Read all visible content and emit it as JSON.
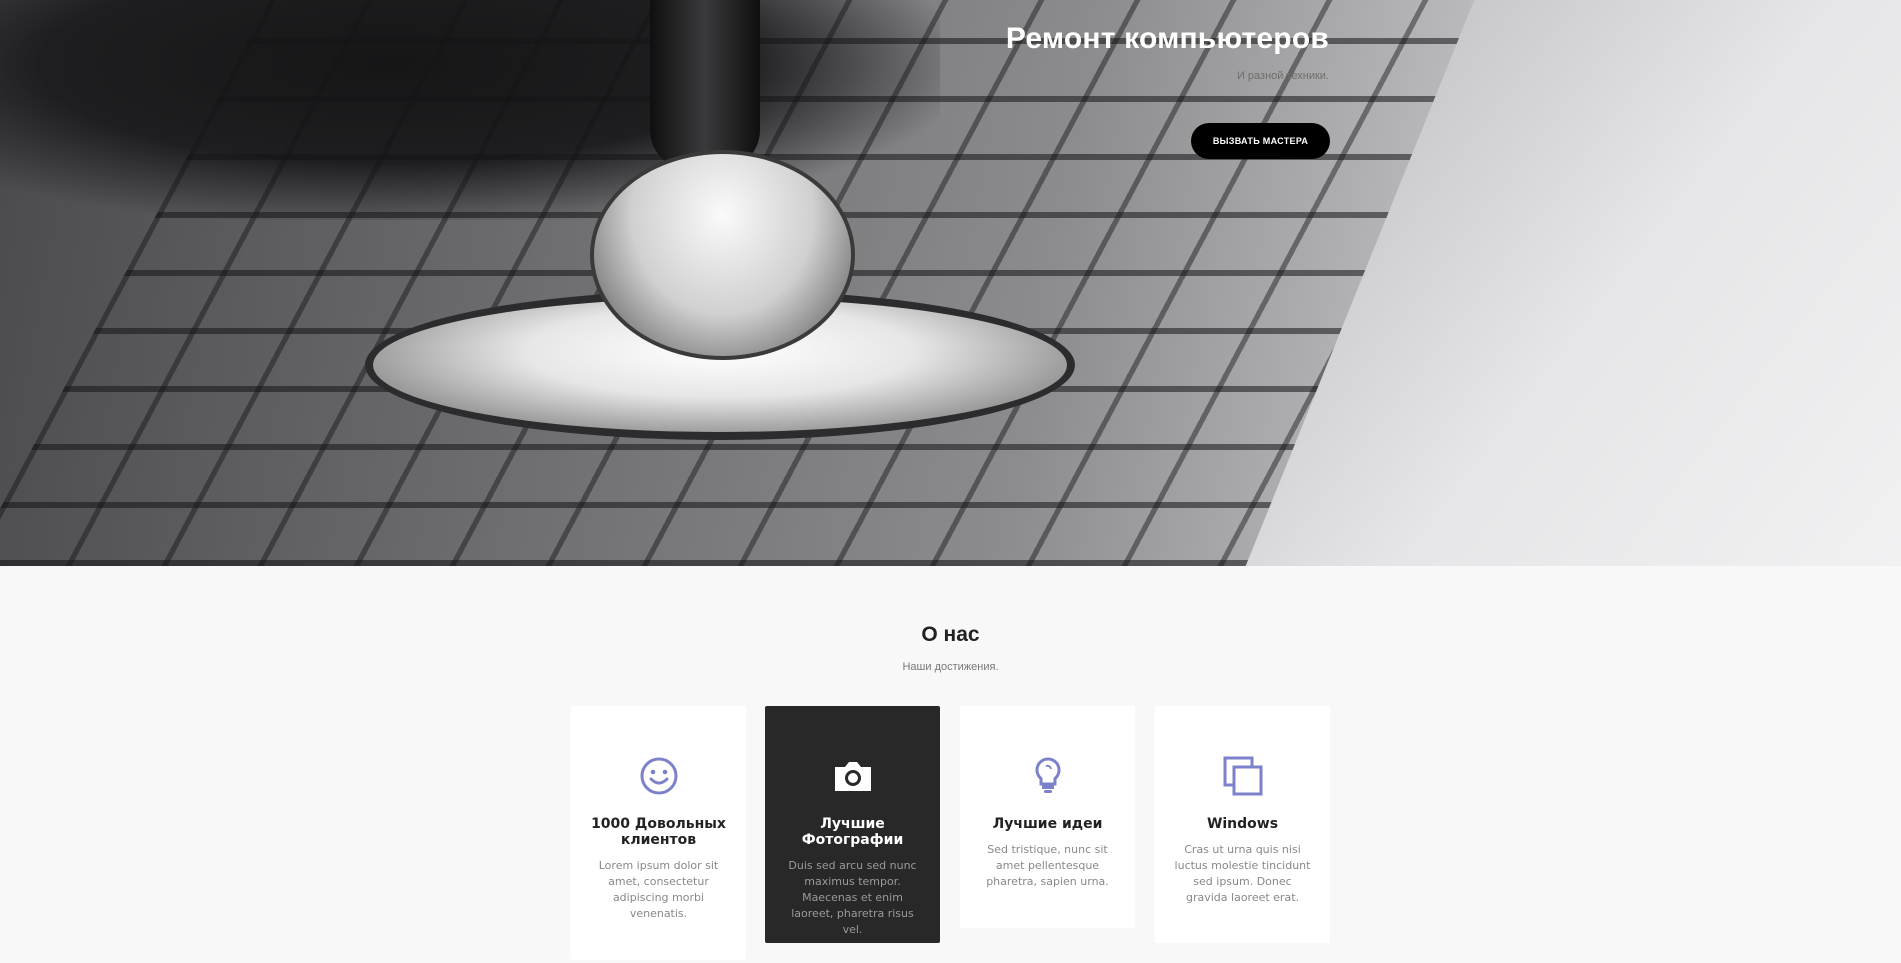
{
  "hero": {
    "title": "Ремонт компьютеров",
    "subtitle": "И разной техники.",
    "button_label": "ВЫЗВАТЬ МАСТЕРА"
  },
  "about": {
    "title": "О нас",
    "subtitle": "Наши достижения.",
    "cards": [
      {
        "icon": "smiley-icon",
        "title": "1000 Довольных клиентов",
        "text": "Lorem ipsum dolor sit amet, consectetur adipiscing morbi venenatis."
      },
      {
        "icon": "camera-icon",
        "title": "Лучшие Фотографии",
        "text": "Duis sed arcu sed nunc maximus tempor. Maecenas et enim laoreet, pharetra risus vel."
      },
      {
        "icon": "lightbulb-icon",
        "title": "Лучшие идеи",
        "text": "Sed tristique, nunc sit amet pellentesque pharetra, sapien urna."
      },
      {
        "icon": "windows-icon",
        "title": "Windows",
        "text": "Cras ut urna quis nisi luctus molestie tincidunt sed ipsum. Donec gravida laoreet erat."
      }
    ]
  },
  "colors": {
    "accent_icon": "#7b82c9",
    "hero_button_bg": "#000000",
    "dark_card_bg": "#282828"
  }
}
